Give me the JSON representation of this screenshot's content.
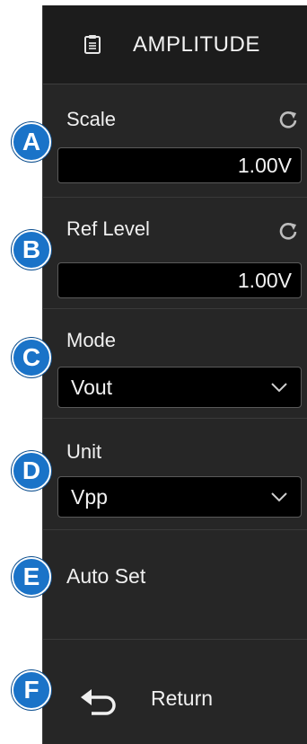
{
  "header": {
    "title": "AMPLITUDE",
    "icon": "clipboard-icon"
  },
  "scale": {
    "label": "Scale",
    "value": "1.00V",
    "reset_icon": "reset-icon"
  },
  "ref_level": {
    "label": "Ref Level",
    "value": "1.00V",
    "reset_icon": "reset-icon"
  },
  "mode": {
    "label": "Mode",
    "selected": "Vout"
  },
  "unit": {
    "label": "Unit",
    "selected": "Vpp"
  },
  "auto_set": {
    "label": "Auto Set"
  },
  "return": {
    "label": "Return",
    "icon": "return-arrow-icon"
  },
  "badges": [
    "A",
    "B",
    "C",
    "D",
    "E",
    "F"
  ],
  "colors": {
    "panel": "#262626",
    "header": "#1c1c1c",
    "field": "#000000",
    "badge": "#1a73c8",
    "text": "#f0f0f0"
  }
}
